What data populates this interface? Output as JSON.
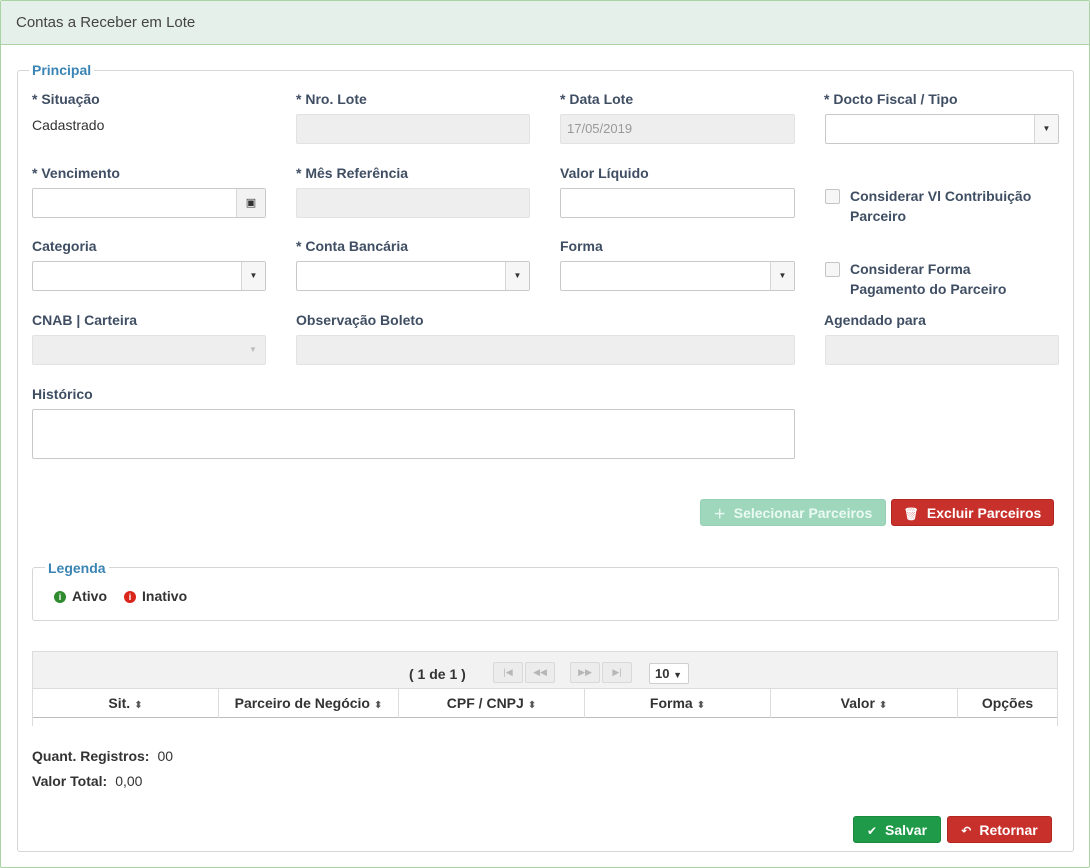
{
  "window": {
    "title": "Contas a Receber em Lote"
  },
  "principal": {
    "legend": "Principal",
    "situacao": {
      "label": "* Situação",
      "value": "Cadastrado"
    },
    "nro_lote": {
      "label": "* Nro. Lote",
      "value": ""
    },
    "data_lote": {
      "label": "* Data Lote",
      "value": "17/05/2019"
    },
    "docto_fiscal": {
      "label": "* Docto Fiscal / Tipo",
      "value": ""
    },
    "vencimento": {
      "label": "* Vencimento",
      "value": ""
    },
    "mes_referencia": {
      "label": "* Mês Referência",
      "value": ""
    },
    "valor_liquido": {
      "label": "Valor Líquido",
      "value": ""
    },
    "considerar_vl": {
      "label_line1": "Considerar Vl Contribuição",
      "label_line2": "Parceiro",
      "checked": false
    },
    "categoria": {
      "label": "Categoria",
      "value": ""
    },
    "conta_bancaria": {
      "label": "* Conta Bancária",
      "value": ""
    },
    "forma": {
      "label": "Forma",
      "value": ""
    },
    "considerar_forma": {
      "label_line1": "Considerar Forma",
      "label_line2": "Pagamento do Parceiro",
      "checked": false
    },
    "cnab": {
      "label": "CNAB | Carteira",
      "value": ""
    },
    "observacao": {
      "label": "Observação Boleto",
      "value": ""
    },
    "agendado": {
      "label": "Agendado para",
      "value": ""
    },
    "historico": {
      "label": "Histórico",
      "value": ""
    },
    "btn_selecionar": "Selecionar Parceiros",
    "btn_excluir": "Excluir Parceiros"
  },
  "legenda": {
    "legend": "Legenda",
    "items": [
      {
        "label": "Ativo",
        "color": "#2e8b2e",
        "icon": "info-icon"
      },
      {
        "label": "Inativo",
        "color": "#d9261c",
        "icon": "info-icon"
      }
    ]
  },
  "table": {
    "page_text": "( 1 de 1 )",
    "rows_per_page": "10",
    "columns": [
      "Sit.",
      "Parceiro de Negócio",
      "CPF / CNPJ",
      "Forma",
      "Valor",
      "Opções"
    ],
    "rows": []
  },
  "summary": {
    "quant_label": "Quant. Registros:",
    "quant_value": "00",
    "total_label": "Valor Total:",
    "total_value": "0,00"
  },
  "actions": {
    "salvar": "Salvar",
    "retornar": "Retornar"
  }
}
